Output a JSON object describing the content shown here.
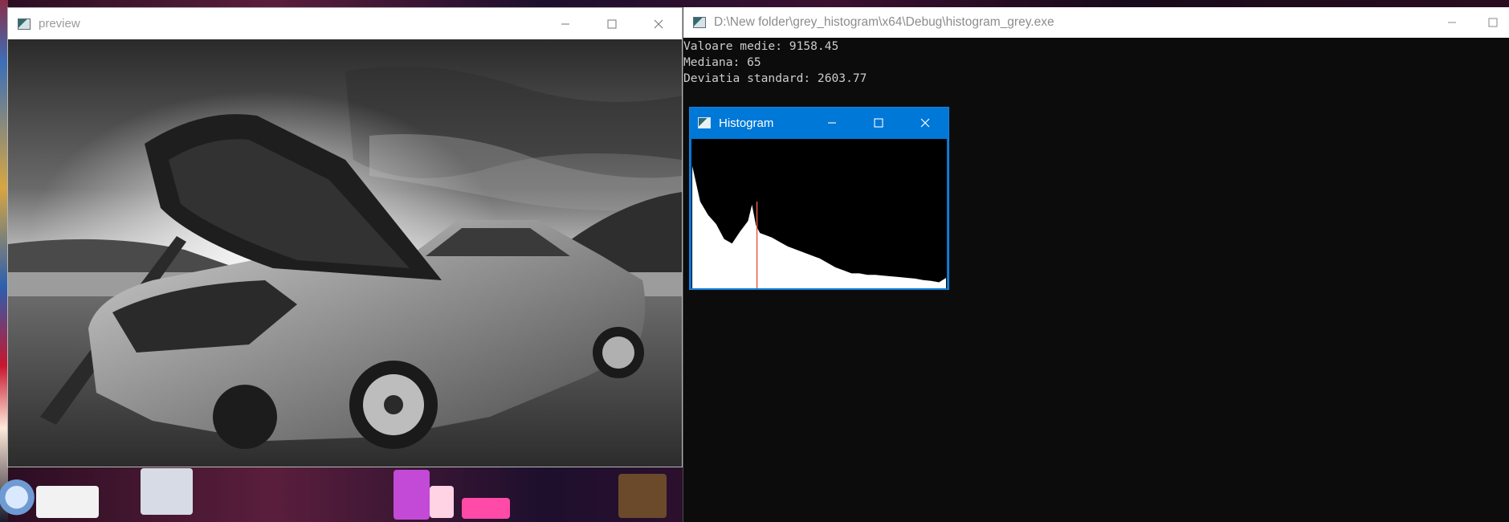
{
  "windows": {
    "preview": {
      "title": "preview",
      "controls": {
        "minimize_icon": "minimize-icon",
        "maximize_icon": "maximize-icon",
        "close_icon": "close-icon"
      },
      "image": {
        "kind": "grayscale photo",
        "subject_icon": "burned-car-photo"
      }
    },
    "console": {
      "title": "D:\\New folder\\grey_histogram\\x64\\Debug\\histogram_grey.exe",
      "lines": [
        "Valoare medie: 9158.45",
        "Mediana: 65",
        "Deviatia standard: 2603.77"
      ],
      "colors": {
        "background": "#0c0c0c",
        "text": "#cccccc"
      }
    },
    "histogram": {
      "title": "Histogram",
      "colors": {
        "background": "#000000",
        "fill": "#ffffff",
        "median_line": "#e35b4a",
        "titlebar": "#0078d7"
      }
    }
  },
  "chart_data": {
    "type": "area",
    "x_range": [
      0,
      255
    ],
    "median_marker": 65,
    "x": [
      0,
      8,
      16,
      24,
      32,
      40,
      48,
      56,
      60,
      64,
      68,
      72,
      80,
      88,
      96,
      104,
      112,
      120,
      128,
      136,
      144,
      152,
      160,
      168,
      176,
      184,
      192,
      200,
      208,
      216,
      224,
      232,
      240,
      248,
      255
    ],
    "values": [
      0.82,
      0.58,
      0.49,
      0.43,
      0.33,
      0.3,
      0.38,
      0.45,
      0.56,
      0.42,
      0.37,
      0.36,
      0.34,
      0.31,
      0.28,
      0.26,
      0.24,
      0.22,
      0.2,
      0.17,
      0.14,
      0.12,
      0.1,
      0.1,
      0.09,
      0.09,
      0.085,
      0.08,
      0.075,
      0.07,
      0.065,
      0.055,
      0.05,
      0.04,
      0.07
    ]
  }
}
